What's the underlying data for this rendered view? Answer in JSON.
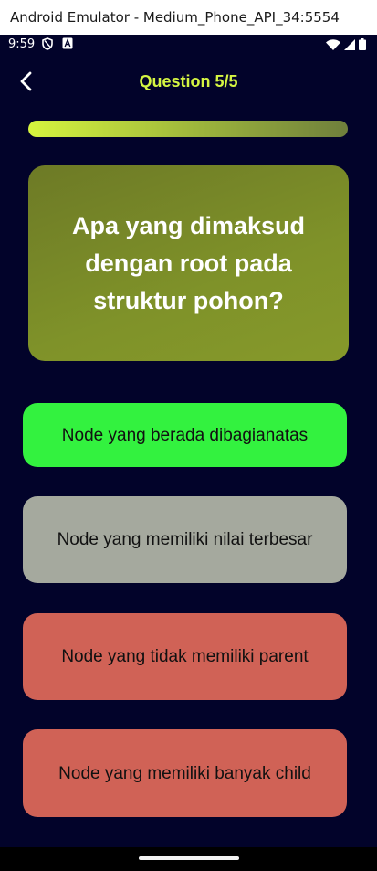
{
  "window": {
    "title": "Android Emulator - Medium_Phone_API_34:5554"
  },
  "statusbar": {
    "time": "9:59",
    "left_icons": [
      "shield-icon",
      "keyboard-a-icon"
    ],
    "right_icons": [
      "wifi-icon",
      "cell-signal-icon",
      "battery-icon"
    ]
  },
  "header": {
    "back_icon": "chevron-left-icon",
    "title": "Question 5/5"
  },
  "progress": {
    "current": 5,
    "total": 5,
    "fraction": 1.0
  },
  "question": {
    "text": "Apa yang dimaksud dengan root pada struktur pohon?"
  },
  "answers": [
    {
      "text": "Node yang berada dibagianatas",
      "state": "correct"
    },
    {
      "text": "Node yang memiliki nilai terbesar",
      "state": "neutral"
    },
    {
      "text": "Node yang tidak memiliki parent",
      "state": "wrong"
    },
    {
      "text": "Node yang memiliki banyak child",
      "state": "wrong"
    }
  ],
  "colors": {
    "background": "#02032a",
    "accent": "#d5f542",
    "question_card": "#7f9229",
    "correct": "#33f23f",
    "neutral": "#a5a99e",
    "wrong": "#d06256"
  }
}
